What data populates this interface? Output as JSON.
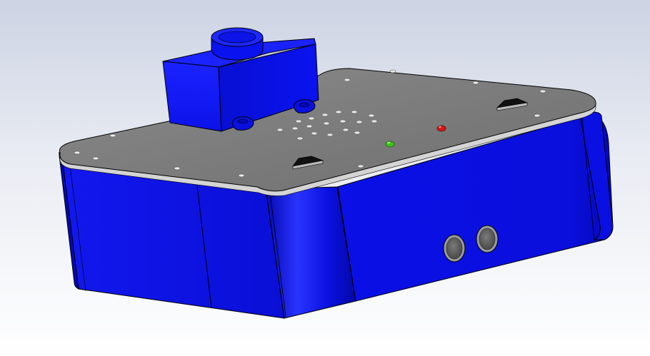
{
  "view": {
    "type": "3d-cad-model-render",
    "background_top": "#cdd3e3",
    "background_bottom": "#ffffff"
  },
  "model": {
    "body_color": "#0a10e0",
    "body_dark": "#0508b8",
    "body_light": "#2a34ff",
    "plate_color": "#7d7d7d",
    "plate_edge_color": "#d4d4d4",
    "edge_line_color": "#000000",
    "led_green": "#3ec11a",
    "led_red": "#d01818",
    "connector_ring": "#9a9a9a",
    "connector_inner": "#5e5e5e",
    "parts": [
      "enclosure-body",
      "top-plate",
      "sensor-block",
      "cylindrical-port",
      "green-led",
      "red-led",
      "left-connector",
      "right-connector",
      "arrow-marker-front",
      "arrow-marker-right",
      "vent-hole-grid"
    ]
  }
}
